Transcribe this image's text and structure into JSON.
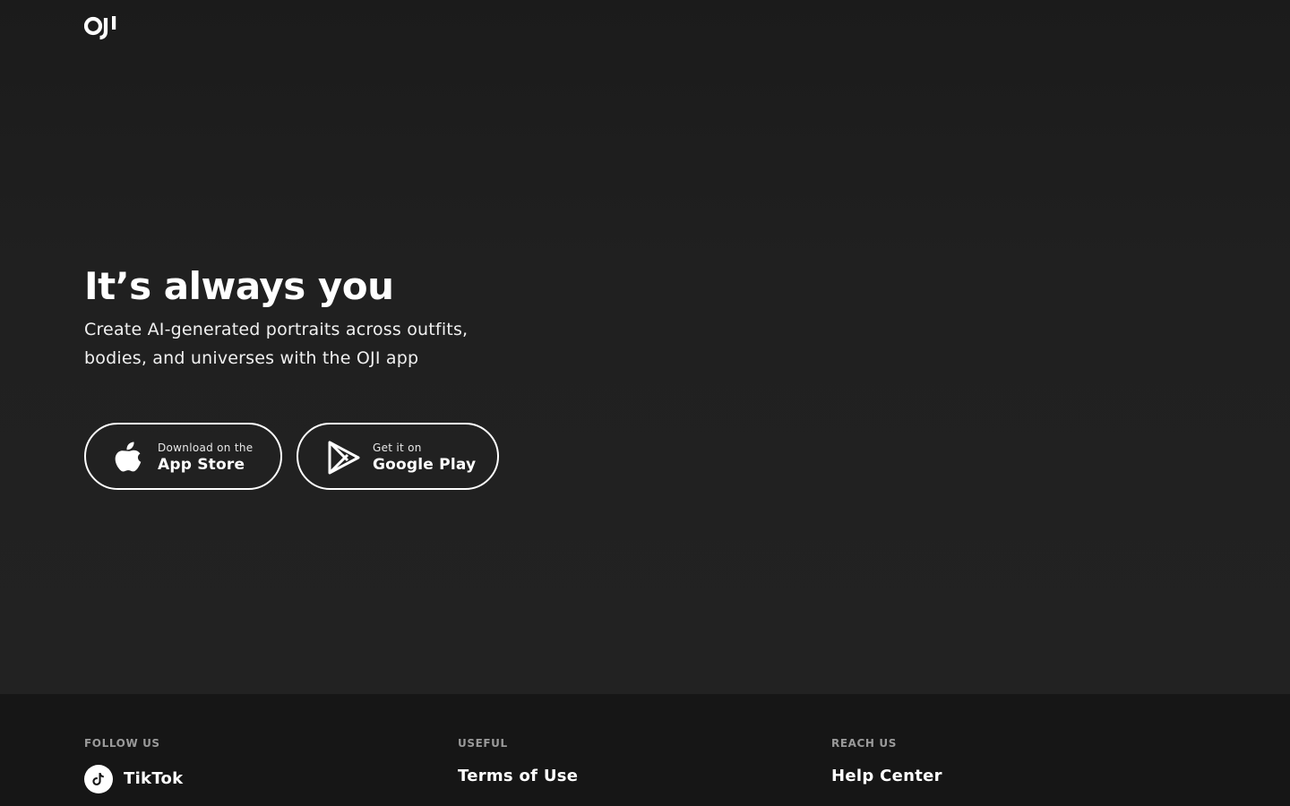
{
  "header": {
    "logo_text": "OJI"
  },
  "hero": {
    "headline": "It’s always you",
    "subtitle": "Create AI-generated portraits across outfits, bodies, and universes with the OJI app",
    "app_store": {
      "small": "Download on the",
      "big": "App Store",
      "icon": "apple-icon"
    },
    "google_play": {
      "small": "Get it on",
      "big": "Google Play",
      "icon": "google-play-icon"
    }
  },
  "footer": {
    "follow": {
      "heading": "FOLLOW US",
      "items": [
        {
          "label": "TikTok",
          "icon": "tiktok-icon"
        }
      ]
    },
    "useful": {
      "heading": "USEFUL",
      "items": [
        {
          "label": "Terms of Use"
        }
      ]
    },
    "reach": {
      "heading": "REACH US",
      "items": [
        {
          "label": "Help Center"
        }
      ]
    }
  },
  "colors": {
    "background": "#202020",
    "footer_background": "#161616",
    "text": "#ffffff",
    "muted": "#9a9a9a"
  }
}
